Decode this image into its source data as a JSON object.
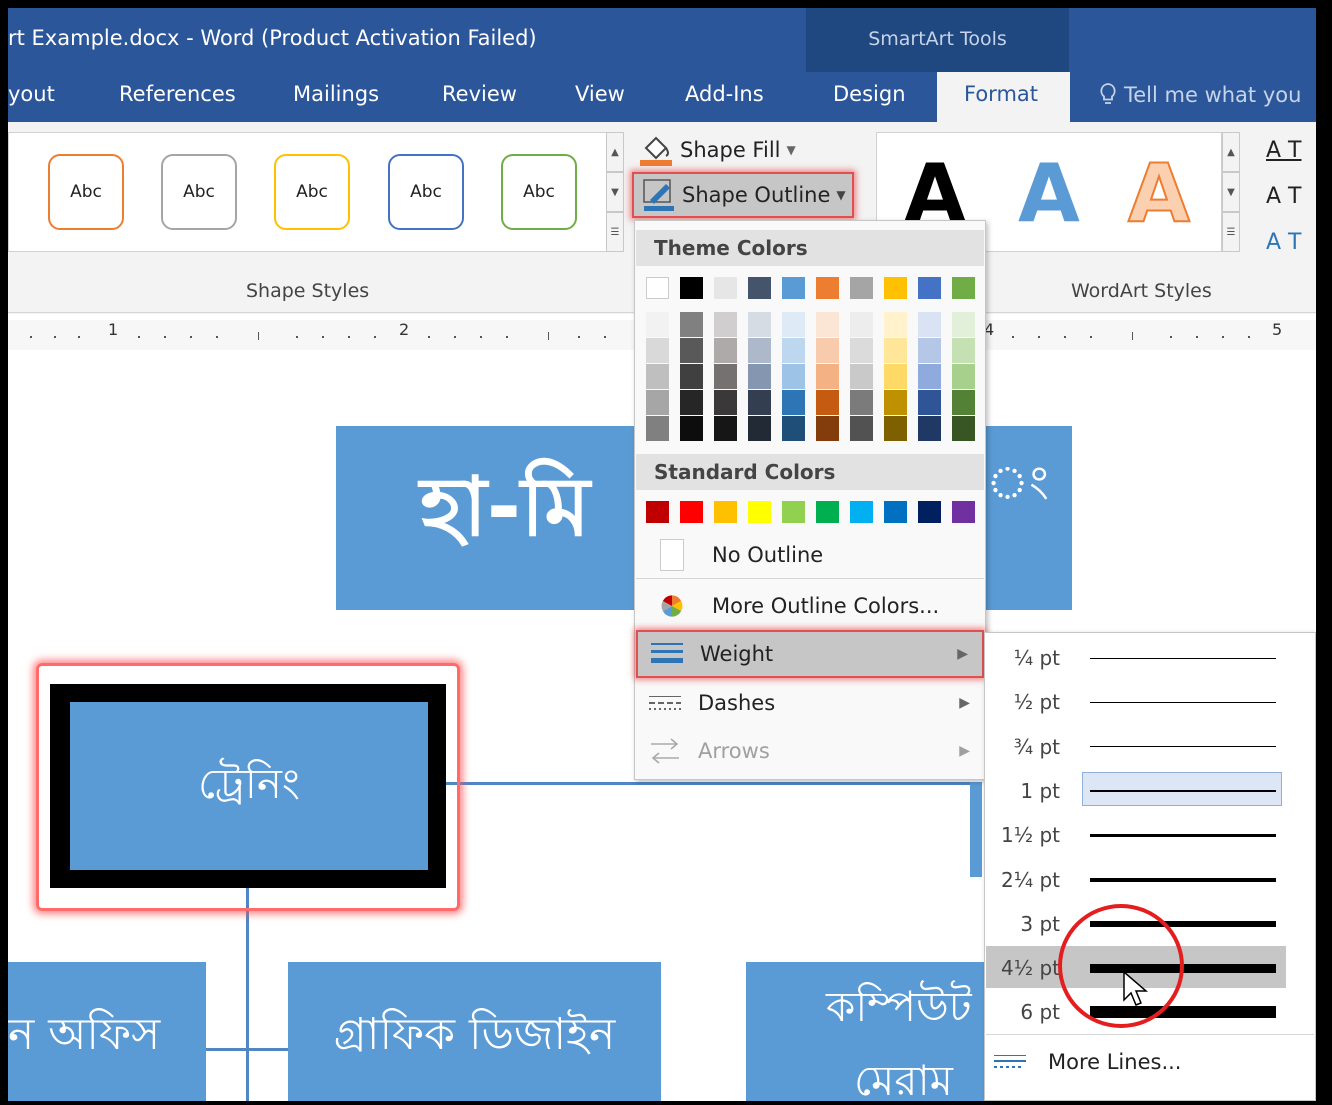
{
  "window": {
    "title": "rt Example.docx - Word (Product Activation Failed)",
    "context_group": "SmartArt Tools",
    "tell_me": "Tell me what you"
  },
  "tabs": [
    "yout",
    "References",
    "Mailings",
    "Review",
    "View",
    "Add-Ins",
    "Design",
    "Format"
  ],
  "ribbon": {
    "shape_styles": {
      "label": "Shape Styles",
      "swatches": [
        {
          "text": "Abc",
          "color": "#ed7d31"
        },
        {
          "text": "Abc",
          "color": "#a5a5a5"
        },
        {
          "text": "Abc",
          "color": "#ffc000"
        },
        {
          "text": "Abc",
          "color": "#4472c4"
        },
        {
          "text": "Abc",
          "color": "#70ad47"
        }
      ]
    },
    "shape_fill": "Shape Fill",
    "shape_outline": "Shape Outline",
    "wordart": {
      "label": "WordArt Styles",
      "letters": [
        "A",
        "A",
        "A"
      ],
      "tools": [
        "A T",
        "A T",
        "A T"
      ]
    }
  },
  "ruler": [
    "1",
    "2",
    "4",
    "5"
  ],
  "document": {
    "title_box": "হা-মি",
    "title_box_tail": "ং",
    "training": "ট্রেনিং",
    "box_left": "ন অফিস",
    "box_mid": "গ্রাফিক ডিজাইন",
    "box_right_1": "কম্পিউট",
    "box_right_2": "মেরাম"
  },
  "outline_menu": {
    "theme_heading": "Theme Colors",
    "standard_heading": "Standard Colors",
    "theme_top": [
      "#ffffff",
      "#000000",
      "#e7e6e6",
      "#44546a",
      "#5b9bd5",
      "#ed7d31",
      "#a5a5a5",
      "#ffc000",
      "#4472c4",
      "#70ad47"
    ],
    "theme_shades": [
      [
        "#f2f2f2",
        "#d9d9d9",
        "#bfbfbf",
        "#a6a6a6",
        "#808080"
      ],
      [
        "#808080",
        "#595959",
        "#404040",
        "#262626",
        "#0d0d0d"
      ],
      [
        "#d0cece",
        "#aeaaaa",
        "#757171",
        "#3a3838",
        "#171616"
      ],
      [
        "#d6dce4",
        "#adb9ca",
        "#8496b0",
        "#333f50",
        "#222a35"
      ],
      [
        "#deebf6",
        "#bdd7ee",
        "#9dc3e6",
        "#2e75b5",
        "#1f4e79"
      ],
      [
        "#fbe5d5",
        "#f7cbac",
        "#f4b183",
        "#c55a11",
        "#833c0b"
      ],
      [
        "#ededed",
        "#dbdbdb",
        "#c9c9c9",
        "#7b7b7b",
        "#525252"
      ],
      [
        "#fff2cc",
        "#ffe699",
        "#ffd966",
        "#bf9000",
        "#7f6000"
      ],
      [
        "#dae3f3",
        "#b4c7e7",
        "#8faadc",
        "#2f5597",
        "#1f3864"
      ],
      [
        "#e2efd9",
        "#c5e0b3",
        "#a8d08d",
        "#538135",
        "#375623"
      ]
    ],
    "standard": [
      "#c00000",
      "#ff0000",
      "#ffc000",
      "#ffff00",
      "#92d050",
      "#00b050",
      "#00b0f0",
      "#0070c0",
      "#002060",
      "#7030a0"
    ],
    "no_outline": "No Outline",
    "more_colors": "More Outline Colors...",
    "weight": "Weight",
    "dashes": "Dashes",
    "arrows": "Arrows"
  },
  "weight_menu": {
    "options": [
      "¼ pt",
      "½ pt",
      "¾ pt",
      "1 pt",
      "1½ pt",
      "2¼ pt",
      "3 pt",
      "4½ pt",
      "6 pt"
    ],
    "selected": "1 pt",
    "hovered": "4½ pt",
    "more_lines": "More Lines..."
  }
}
